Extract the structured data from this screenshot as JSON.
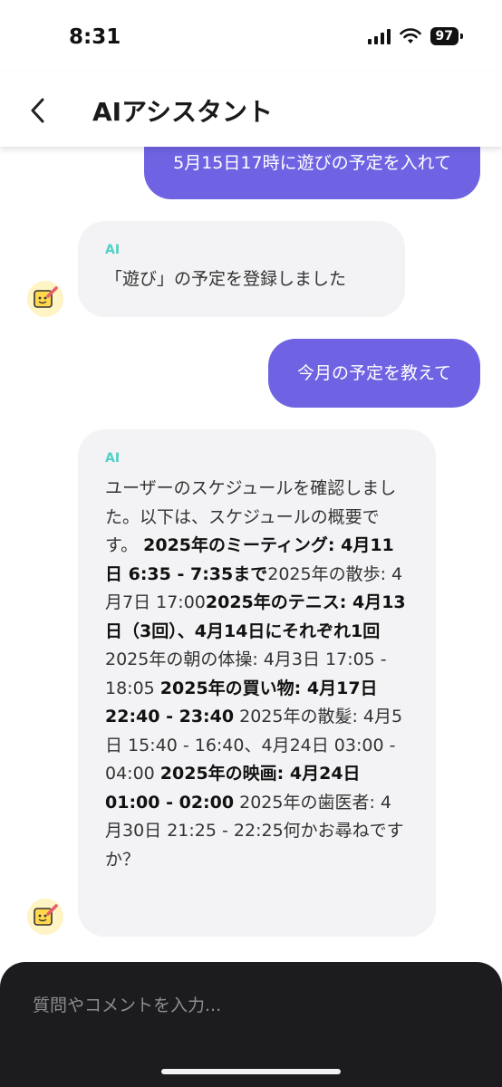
{
  "status": {
    "time": "8:31",
    "battery": "97"
  },
  "header": {
    "title": "AIアシスタント"
  },
  "messages": {
    "user1": "5月15日17時に遊びの予定を入れて",
    "ai1_label": "AI",
    "ai1_text": "「遊び」の予定を登録しました",
    "user2": "今月の予定を教えて",
    "ai2_label": "AI",
    "ai2_segments": [
      "ユーザーのスケジュールを確認しました。以下は、スケジュールの概要です。 ",
      "2025年のミーティング: 4月11日 6:35 - 7:35まで",
      "2025年の散歩: 4月7日 17:00",
      "2025年のテニス: 4月13日（3回）、4月14日にそれぞれ1回",
      "2025年の朝の体操: 4月3日 17:05 - 18:05 ",
      "2025年の買い物: 4月17日 22:40 - 23:40",
      " 2025年の散髪: 4月5日 15:40 - 16:40、4月24日 03:00 - 04:00 ",
      "2025年の映画: 4月24日 01:00 - 02:00",
      " 2025年の歯医者: 4月30日 21:25 - 22:25何かお尋ねですか？"
    ]
  },
  "composer": {
    "placeholder": "質問やコメントを入力..."
  },
  "colors": {
    "user_bubble": "#6f63e3",
    "ai_bubble": "#f3f3f5",
    "ai_label": "#4fd1c5",
    "composer": "#1c1c1f"
  },
  "icons": {
    "back": "chevron-left-icon",
    "avatar": "smiling-notepad-pencil-icon"
  }
}
